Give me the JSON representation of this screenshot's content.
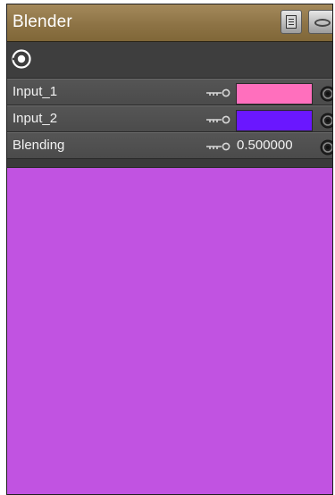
{
  "window": {
    "title": "Blender"
  },
  "colors": {
    "title_bar": "#8f7549",
    "panel_bg": "#3a3a3a",
    "row_bg": "#505050",
    "input1_swatch": "#ff6fbd",
    "input2_swatch": "#6a17ff",
    "preview": "#c153e1"
  },
  "toolbar": {
    "icons": [
      "list-menu-icon",
      "eye-icon"
    ],
    "target_icon": "target-icon"
  },
  "properties": [
    {
      "label": "Input_1",
      "type": "color",
      "value_color": "#ff6fbd"
    },
    {
      "label": "Input_2",
      "type": "color",
      "value_color": "#6a17ff"
    },
    {
      "label": "Blending",
      "type": "number",
      "value": "0.500000"
    }
  ]
}
